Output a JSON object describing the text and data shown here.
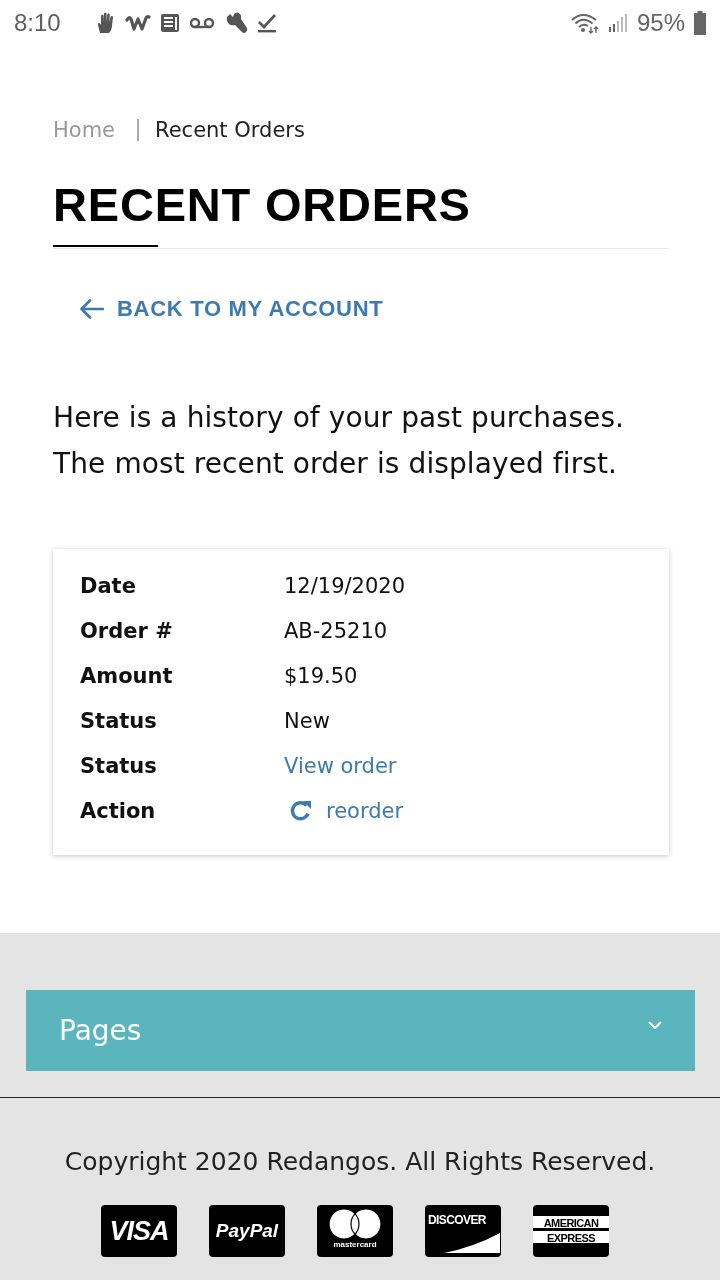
{
  "status_bar": {
    "time": "8:10",
    "battery": "95%"
  },
  "breadcrumb": [
    {
      "label": "Home",
      "current": false
    },
    {
      "label": "Recent Orders",
      "current": true
    }
  ],
  "title": "RECENT ORDERS",
  "back_link": "BACK TO MY ACCOUNT",
  "intro": "Here is a history of your past purchases. The most recent order is displayed first.",
  "order": [
    {
      "label": "Date",
      "value": "12/19/2020",
      "kind": "text"
    },
    {
      "label": "Order #",
      "value": "AB-25210",
      "kind": "text"
    },
    {
      "label": "Amount",
      "value": "$19.50",
      "kind": "text"
    },
    {
      "label": "Status",
      "value": "New",
      "kind": "text"
    },
    {
      "label": "Status",
      "value": "View order",
      "kind": "link"
    },
    {
      "label": "Action",
      "value": "reorder",
      "kind": "action"
    }
  ],
  "footer": {
    "accordion": {
      "label": "Pages",
      "expanded": false
    },
    "copyright": "Copyright 2020 Redangos. All Rights Reserved.",
    "payment_logos": [
      {
        "kind": "visa",
        "label": "VISA"
      },
      {
        "kind": "paypal",
        "label": "PayPal"
      },
      {
        "kind": "mastercard",
        "label": "mastercard"
      },
      {
        "kind": "discover",
        "label": "DISCOVER"
      },
      {
        "kind": "amex",
        "label": "AMERICAN EXPRESS"
      }
    ]
  }
}
